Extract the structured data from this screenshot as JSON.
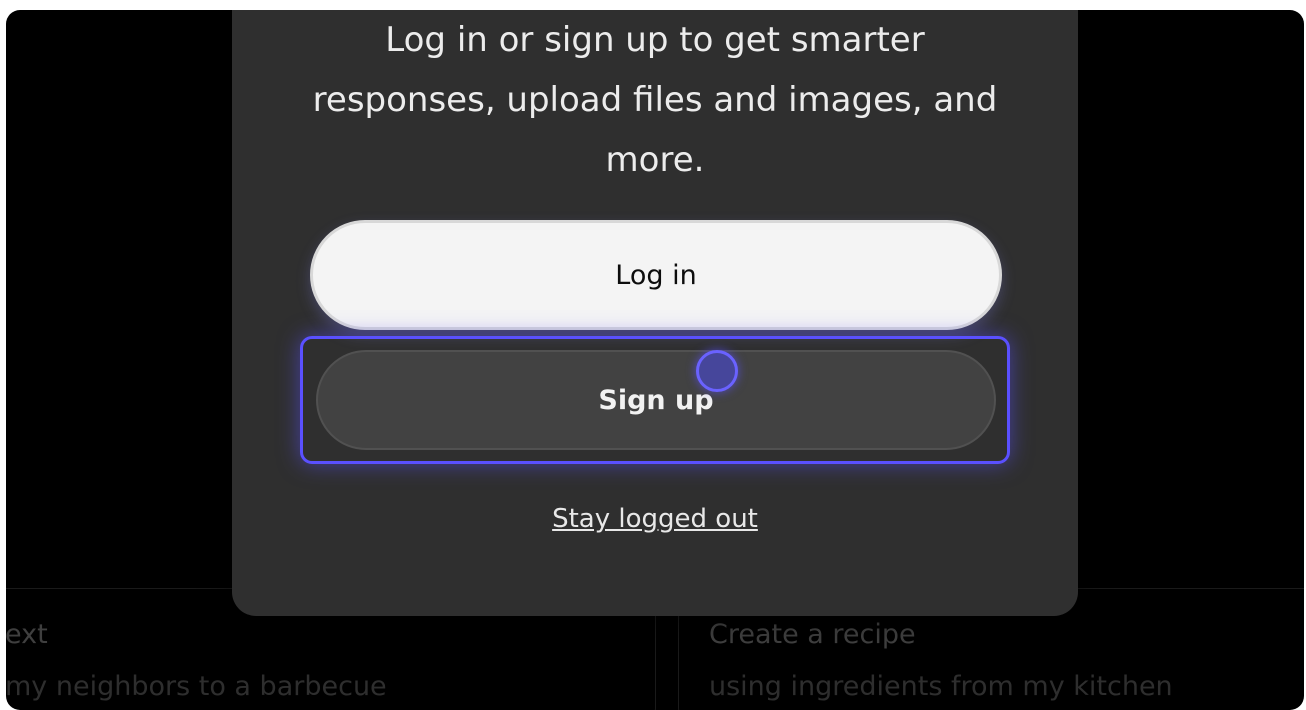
{
  "background_cards": [
    {
      "title": "ext",
      "subtitle": "my neighbors to a barbecue"
    },
    {
      "title": "Create a recipe",
      "subtitle": "using ingredients from my kitchen"
    }
  ],
  "modal": {
    "message": "Log in or sign up to get smarter responses, upload files and images, and more.",
    "login_label": "Log in",
    "signup_label": "Sign up",
    "stay_logged_out_label": "Stay logged out"
  },
  "colors": {
    "focus_ring": "#5a50ff",
    "modal_bg": "#2f2f2f",
    "login_bg": "#f4f4f4",
    "signup_bg": "#424242"
  }
}
